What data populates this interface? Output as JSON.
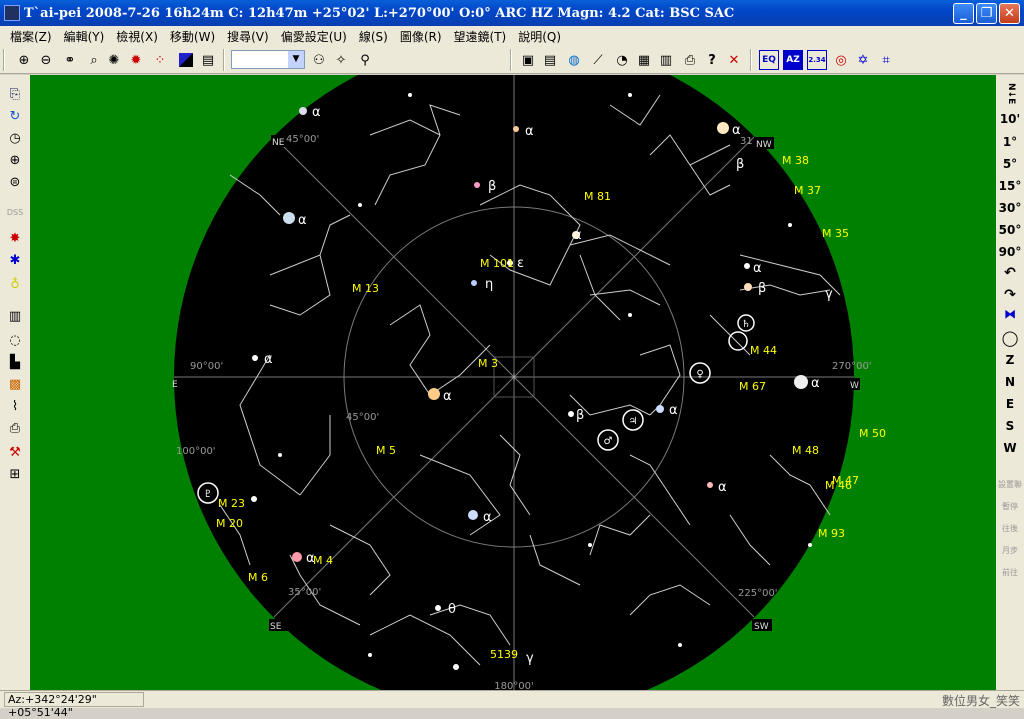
{
  "window": {
    "title": "T`ai-pei 2008-7-26  16h24m C: 12h47m +25°02' L:+270°00' O:0° ARC HZ  Magn: 4.2 Cat: BSC SAC",
    "minimize": "_",
    "maximize": "❐",
    "close": "✕"
  },
  "menu": [
    "檔案(Z)",
    "編輯(Y)",
    "檢視(X)",
    "移動(W)",
    "搜尋(V)",
    "偏愛設定(U)",
    "線(S)",
    "圖像(R)",
    "望遠鏡(T)",
    "說明(Q)"
  ],
  "toolbar": {
    "zoom_in": "🔍+",
    "zoom_out": "🔍−",
    "combo_value": "",
    "combo_arrow": "▼",
    "help": "?",
    "cancel": "✕",
    "eq": "EQ",
    "az": "AZ",
    "ratio": "2.34"
  },
  "right_toolbar": {
    "fov_labels": [
      "10'",
      "1°",
      "5°",
      "15°",
      "30°",
      "50°",
      "90°"
    ],
    "directions": [
      "Z",
      "N",
      "E",
      "S",
      "W"
    ],
    "vertical_label": "N↓E",
    "bottom_labels": [
      "設置聯",
      "暫停",
      "往後",
      "月步",
      "前往"
    ]
  },
  "status": {
    "coords": "Az:+342°24'29\" +05°51'44\"",
    "watermark": "數位男女_笑笑"
  },
  "sky": {
    "colors": {
      "background": "#008000",
      "sky": "#000000",
      "grid": "#808080",
      "label": "#ffff00",
      "greek": "#ffffff"
    },
    "directions": {
      "ne": "NE",
      "nw": "NW",
      "e": "E",
      "w": "W",
      "se": "SE",
      "sw": "SW"
    },
    "grid_labels": {
      "ne_45": "45°00'",
      "nw_31": "31",
      "e_90": "90°00'",
      "w_270": "270°00'",
      "inner_45": "45°00'",
      "e_100": "100°00'",
      "se_35": "35°00'",
      "sw_225": "225°00'",
      "s_180": "180°00'"
    },
    "messier": [
      "M 38",
      "M 37",
      "M 81",
      "M 35",
      "M 13",
      "M 101",
      "M 3",
      "M 44",
      "M 67",
      "M 5",
      "M 50",
      "M 48",
      "M 47",
      "M 46",
      "M 23",
      "M 20",
      "M 93",
      "M 6",
      "M 4",
      "5139"
    ],
    "greek": {
      "a1": "α",
      "a2": "α",
      "a3": "α",
      "b1": "β",
      "a4": "α",
      "eps": "ε",
      "eta": "η",
      "a5": "α",
      "b2": "β",
      "g1": "γ",
      "a6": "α",
      "a7": "α",
      "a8": "α",
      "a9": "α",
      "b3": "β",
      "a10": "α",
      "a11": "α",
      "a12": "α",
      "theta": "θ",
      "g2": "γ",
      "b4": "β",
      "a13": "α"
    }
  }
}
